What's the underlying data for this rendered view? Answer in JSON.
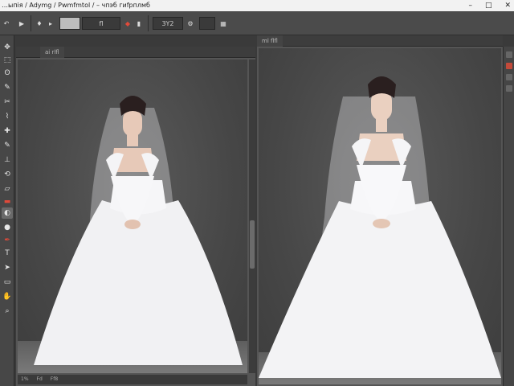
{
  "title": "…ыпія / Adymg / Pwmfmtol / – чпэб гиfрплмб",
  "window_controls": [
    "–",
    "□",
    "✕"
  ],
  "options_bar": {
    "zoom_field": "",
    "field_a": "",
    "field_b": "fl",
    "field_c": "3Y2",
    "field_d": ""
  },
  "left_doc": {
    "tab": "ai  rlfl"
  },
  "right_doc": {
    "tab": "ml  flfl"
  },
  "left_status": [
    "1%",
    "Fd",
    "Ff8"
  ],
  "icons": {
    "tools": [
      "move-icon",
      "marquee-icon",
      "lasso-icon",
      "quick-select-icon",
      "crop-icon",
      "eyedropper-icon",
      "healing-icon",
      "brush-icon",
      "stamp-icon",
      "history-brush-icon",
      "eraser-icon",
      "gradient-icon",
      "blur-icon",
      "dodge-icon",
      "pen-icon",
      "type-icon",
      "path-select-icon",
      "shape-icon",
      "hand-icon",
      "zoom-icon"
    ]
  },
  "colors": {
    "accent_red": "#e04a3a",
    "ui_dark": "#3a3a3a"
  }
}
